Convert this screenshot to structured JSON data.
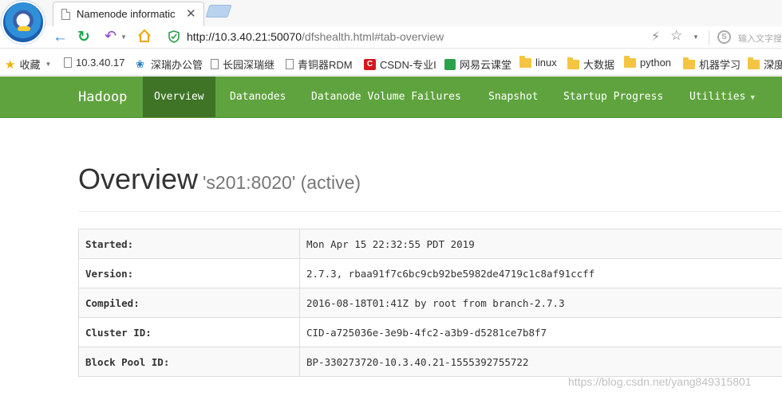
{
  "browser": {
    "tab_title": "Namenode informatic",
    "tab_close": "✕",
    "url_host": "http://10.3.40.21:50070",
    "url_path": "/dfshealth.html#tab-overview",
    "search_placeholder": "输入文字搜"
  },
  "bookmarks": [
    {
      "label": "收藏",
      "icon": "star-icon"
    },
    {
      "label": "10.3.40.17",
      "icon": "page-icon"
    },
    {
      "label": "深瑞办公管",
      "icon": "fan-icon"
    },
    {
      "label": "长园深瑞继",
      "icon": "page-icon"
    },
    {
      "label": "青铜器RDM",
      "icon": "page-icon"
    },
    {
      "label": "CSDN-专业I",
      "icon": "csdn-icon"
    },
    {
      "label": "网易云课堂",
      "icon": "netease-icon"
    },
    {
      "label": "linux",
      "icon": "folder-icon"
    },
    {
      "label": "大数据",
      "icon": "folder-icon"
    },
    {
      "label": "python",
      "icon": "folder-icon"
    },
    {
      "label": "机器学习",
      "icon": "folder-icon"
    },
    {
      "label": "深度",
      "icon": "folder-icon"
    }
  ],
  "navbar": {
    "brand": "Hadoop",
    "items": [
      {
        "label": "Overview",
        "active": true
      },
      {
        "label": "Datanodes",
        "active": false
      },
      {
        "label": "Datanode Volume Failures",
        "active": false
      },
      {
        "label": "Snapshot",
        "active": false
      },
      {
        "label": "Startup Progress",
        "active": false
      },
      {
        "label": "Utilities",
        "active": false,
        "dropdown": true
      }
    ],
    "colors": {
      "bar": "#5fa33e",
      "active": "#3f7427"
    }
  },
  "page": {
    "title": "Overview",
    "subtitle": "'s201:8020' (active)"
  },
  "overview_table": [
    {
      "key": "Started:",
      "value": "Mon Apr 15 22:32:55 PDT 2019"
    },
    {
      "key": "Version:",
      "value": "2.7.3, rbaa91f7c6bc9cb92be5982de4719c1c8af91ccff"
    },
    {
      "key": "Compiled:",
      "value": "2016-08-18T01:41Z by root from branch-2.7.3"
    },
    {
      "key": "Cluster ID:",
      "value": "CID-a725036e-3e9b-4fc2-a3b9-d5281ce7b8f7"
    },
    {
      "key": "Block Pool ID:",
      "value": "BP-330273720-10.3.40.21-1555392755722"
    }
  ],
  "watermark": "https://blog.csdn.net/yang849315801"
}
